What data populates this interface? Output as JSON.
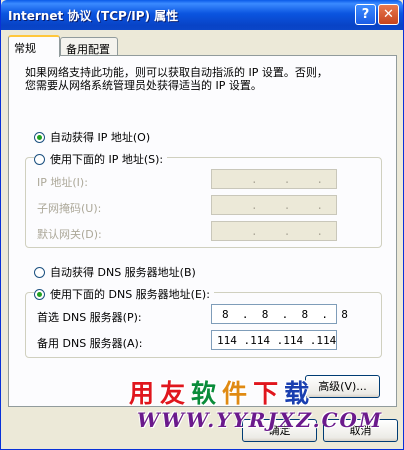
{
  "window": {
    "title": "Internet 协议 (TCP/IP) 属性",
    "help_label": "?",
    "close_label": "✕"
  },
  "tabs": [
    {
      "label": "常规",
      "active": true
    },
    {
      "label": "备用配置",
      "active": false
    }
  ],
  "description": {
    "line1": "如果网络支持此功能，则可以获取自动指派的 IP 设置。否则，",
    "line2": "您需要从网络系统管理员处获得适当的 IP 设置。"
  },
  "ip_section": {
    "auto_option": "自动获得 IP 地址(O)",
    "manual_option": "使用下面的 IP 地址(S):",
    "selected": "auto",
    "fields": [
      {
        "label": "IP 地址(I):",
        "octets": [
          "",
          ".",
          ".",
          "."
        ]
      },
      {
        "label": "子网掩码(U):",
        "octets": [
          "",
          ".",
          ".",
          "."
        ]
      },
      {
        "label": "默认网关(D):",
        "octets": [
          "",
          ".",
          ".",
          "."
        ]
      }
    ]
  },
  "dns_section": {
    "auto_option": "自动获得 DNS 服务器地址(B)",
    "manual_option": "使用下面的 DNS 服务器地址(E):",
    "selected": "manual",
    "preferred": {
      "label": "首选 DNS 服务器(P):",
      "value": "8  .  8  .  8  .  8"
    },
    "alternate": {
      "label": "备用 DNS 服务器(A):",
      "value": "114 .114 .114 .114"
    }
  },
  "buttons": {
    "advanced": "高级(V)...",
    "ok": "确定",
    "cancel": "取消"
  },
  "watermark": {
    "chars": [
      "用",
      "友",
      "软",
      "件",
      "下",
      "载"
    ],
    "char_colors": [
      "#e0161d",
      "#e0161d",
      "#0a8c3a",
      "#e08a12",
      "#e0161d",
      "#1a3fb0"
    ],
    "url": "WWW.YYRJXZ.COM",
    "url_color": "#6b1a8c"
  },
  "colors": {
    "titlebar": "#0a46c8",
    "dialog_bg": "#ece9d8",
    "radio_dot": "#21a121",
    "tab_highlight": "#ffc73c"
  }
}
